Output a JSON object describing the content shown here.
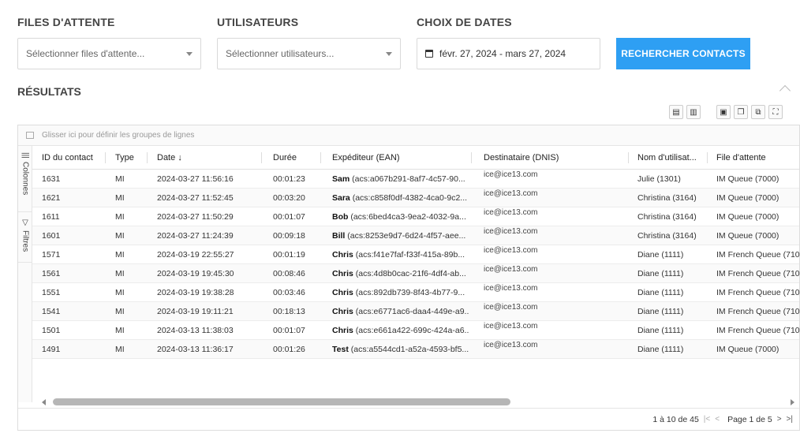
{
  "filters": {
    "queues_label": "FILES D'ATTENTE",
    "queues_placeholder": "Sélectionner files d'attente...",
    "users_label": "UTILISATEURS",
    "users_placeholder": "Sélectionner utilisateurs...",
    "dates_label": "CHOIX DE DATES",
    "date_range": "févr. 27, 2024 - mars 27, 2024",
    "search_button": "RECHERCHER CONTACTS"
  },
  "results": {
    "title": "RÉSULTATS",
    "group_hint": "Glisser ici pour définir les groupes de lignes",
    "side_columns": "Colonnes",
    "side_filters": "Filtres",
    "columns": [
      "ID du contact",
      "Type",
      "Date",
      "Durée",
      "Expéditeur (EAN)",
      "Destinataire (DNIS)",
      "Nom d'utilisat...",
      "File d'attente"
    ],
    "sort_arrow": "↓",
    "rows": [
      {
        "id": "1631",
        "type": "MI",
        "date": "2024-03-27 11:56:16",
        "duration": "00:01:23",
        "sender_name": "Sam",
        "sender_rest": " (acs:a067b291-8af7-4c57-90...",
        "dnis": "ice@ice13.com",
        "user": "Julie (1301)",
        "queue": "IM Queue (7000)"
      },
      {
        "id": "1621",
        "type": "MI",
        "date": "2024-03-27 11:52:45",
        "duration": "00:03:20",
        "sender_name": "Sara",
        "sender_rest": " (acs:c858f0df-4382-4ca0-9c2...",
        "dnis": "ice@ice13.com",
        "user": "Christina (3164)",
        "queue": "IM Queue (7000)"
      },
      {
        "id": "1611",
        "type": "MI",
        "date": "2024-03-27 11:50:29",
        "duration": "00:01:07",
        "sender_name": "Bob",
        "sender_rest": " (acs:6bed4ca3-9ea2-4032-9a...",
        "dnis": "ice@ice13.com",
        "user": "Christina (3164)",
        "queue": "IM Queue (7000)"
      },
      {
        "id": "1601",
        "type": "MI",
        "date": "2024-03-27 11:24:39",
        "duration": "00:09:18",
        "sender_name": "Bill",
        "sender_rest": " (acs:8253e9d7-6d24-4f57-aee...",
        "dnis": "ice@ice13.com",
        "user": "Christina (3164)",
        "queue": "IM Queue (7000)"
      },
      {
        "id": "1571",
        "type": "MI",
        "date": "2024-03-19 22:55:27",
        "duration": "00:01:19",
        "sender_name": "Chris",
        "sender_rest": " (acs:f41e7faf-f33f-415a-89b...",
        "dnis": "ice@ice13.com",
        "user": "Diane (1111)",
        "queue": "IM French Queue (710"
      },
      {
        "id": "1561",
        "type": "MI",
        "date": "2024-03-19 19:45:30",
        "duration": "00:08:46",
        "sender_name": "Chris",
        "sender_rest": " (acs:4d8b0cac-21f6-4df4-ab...",
        "dnis": "ice@ice13.com",
        "user": "Diane (1111)",
        "queue": "IM French Queue (710"
      },
      {
        "id": "1551",
        "type": "MI",
        "date": "2024-03-19 19:38:28",
        "duration": "00:03:46",
        "sender_name": "Chris",
        "sender_rest": " (acs:892db739-8f43-4b77-9...",
        "dnis": "ice@ice13.com",
        "user": "Diane (1111)",
        "queue": "IM French Queue (710"
      },
      {
        "id": "1541",
        "type": "MI",
        "date": "2024-03-19 19:11:21",
        "duration": "00:18:13",
        "sender_name": "Chris",
        "sender_rest": " (acs:e6771ac6-daa4-449e-a9...",
        "dnis": "ice@ice13.com",
        "user": "Diane (1111)",
        "queue": "IM French Queue (710"
      },
      {
        "id": "1501",
        "type": "MI",
        "date": "2024-03-13 11:38:03",
        "duration": "00:01:07",
        "sender_name": "Chris",
        "sender_rest": " (acs:e661a422-699c-424a-a6...",
        "dnis": "ice@ice13.com",
        "user": "Diane (1111)",
        "queue": "IM French Queue (710"
      },
      {
        "id": "1491",
        "type": "MI",
        "date": "2024-03-13 11:36:17",
        "duration": "00:01:26",
        "sender_name": "Test",
        "sender_rest": " (acs:a5544cd1-a52a-4593-bf5...",
        "dnis": "ice@ice13.com",
        "user": "Diane (1111)",
        "queue": "IM Queue (7000)"
      }
    ],
    "footer_count": "1 à 10 de 45",
    "footer_page": "Page 1 de 5"
  }
}
